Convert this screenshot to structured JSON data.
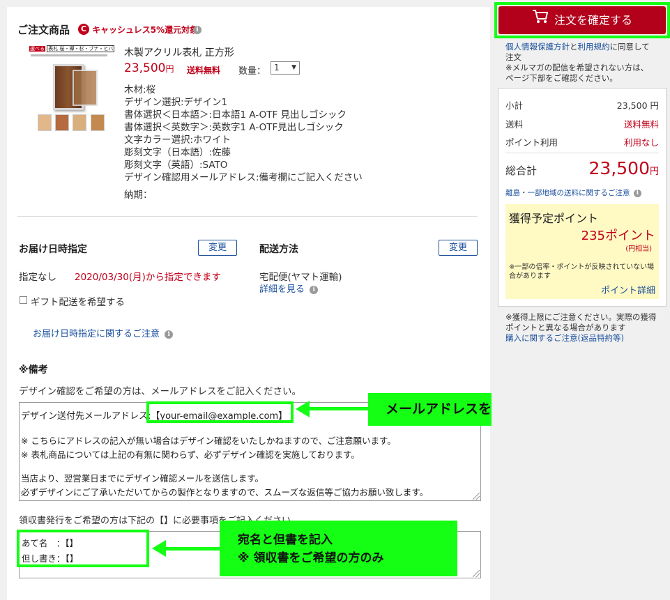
{
  "order_section": {
    "title": "ご注文商品",
    "cashless_text": "キャッシュレス5%還元対象",
    "product": {
      "name": "木製アクリル表札 正方形",
      "price": "23,500",
      "price_unit": "円",
      "shipping": "送料無料",
      "qty_label": "数量：",
      "qty_value": "1",
      "thumb_banner_label": "選べる",
      "thumb_banner_text": "表札 桜・欅・杉・ブナ・ヒバ",
      "options": [
        "木材:桜",
        "デザイン選択:デザイン1",
        "書体選択＜日本語＞:日本語1 A-OTF 見出しゴシック",
        "書体選択＜英数字＞:英数字1 A-OTF見出しゴシック",
        "文字カラー選択:ホワイト",
        "彫刻文字（日本語）:佐藤",
        "彫刻文字（英語）:SATO",
        "デザイン確認用メールアドレス:備考欄にご記入ください"
      ],
      "delivery_period_label": "納期："
    }
  },
  "delivery_date": {
    "title": "お届け日時指定",
    "change_label": "変更",
    "value": "指定なし",
    "available_text": "2020/03/30(月)から指定できます",
    "gift_label": "ギフト配送を希望する",
    "notice_link": "お届け日時指定に関するご注意"
  },
  "shipping_method": {
    "title": "配送方法",
    "change_label": "変更",
    "value": "宅配便(ヤマト運輸)",
    "detail_link": "詳細を見る"
  },
  "remarks": {
    "title": "※備考",
    "instruction": "デザイン確認をご希望の方は、メールアドレスをご記入ください。",
    "line1_prefix": "デザイン送付先メールアドレス:",
    "line1_email": "【your-email@example.com】",
    "line2": "※ こちらにアドレスの記入が無い場合はデザイン確認をいたしかねますので、ご注意願います。",
    "line3": "※ 表札商品については上記の有無に関わらず、必ずデザイン確認を実施しております。",
    "line4": "当店より、翌営業日までにデザイン確認メールを送信します。",
    "line5": "必ずデザインにご了承いただいてからの製作となりますので、スムーズな返信等ご協力お願い致します。",
    "receipt_instruction": "領収書発行をご希望の方は下記の【】に必要事項をご記入ください。",
    "receipt_name": "あて名　：【】",
    "receipt_note": "但し書き：【】"
  },
  "annotations": {
    "email_callout": "メールアドレスを記入",
    "receipt_callout_line1": "宛名と但書を記入",
    "receipt_callout_line2": "※ 領収書をご希望の方のみ"
  },
  "sidebar": {
    "confirm_button": "注文を確定する",
    "privacy_link": "個人情報保護方針",
    "and_text": "と",
    "terms_link": "利用規約",
    "agree_text": "に同意して",
    "agree_text2": "注文",
    "mailmag_note": "※メルマガの配信を希望されない方は、",
    "mailmag_note2": "ページ下部をご確認ください。",
    "summary": {
      "subtotal_label": "小計",
      "subtotal_value": "23,500 円",
      "shipping_label": "送料",
      "shipping_value": "送料無料",
      "points_label": "ポイント利用",
      "points_value": "利用なし",
      "total_label": "総合計",
      "total_value": "23,500",
      "total_unit": "円",
      "island_link": "離島・一部地域の送料に関するご注意"
    },
    "points_box": {
      "title": "獲得予定ポイント",
      "value": "235ポイント",
      "sub": "(円相当)",
      "note": "※一部の倍率・ポイントが反映されていない場",
      "note2": "合があります",
      "detail_link": "ポイント詳細"
    },
    "limit_note": "※獲得上限にご注意ください。実際の獲得",
    "limit_note2": "ポイントと異なる場合があります",
    "purchase_link": "購入に関するご注意(返品特約等)"
  },
  "colors": {
    "brand_red": "#c1001a",
    "link_blue": "#1a4f9c",
    "highlight_green": "#14ff14",
    "points_bg": "#fff9c4"
  }
}
